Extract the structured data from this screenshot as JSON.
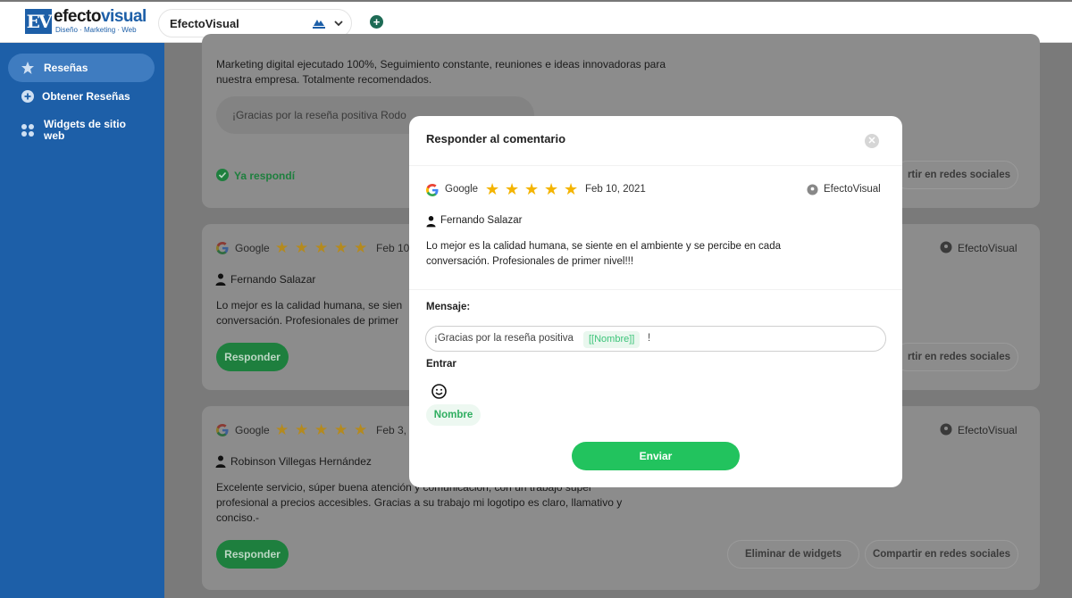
{
  "header": {
    "logo_word_a": "efecto",
    "logo_word_b": "visual",
    "logo_tagline": "Diseño · Marketing · Web",
    "account": "EfectoVisual"
  },
  "sidebar": {
    "items": [
      {
        "label": "Reseñas"
      },
      {
        "label": "Obtener Reseñas"
      },
      {
        "label": "Widgets de sitio web"
      }
    ]
  },
  "cards": [
    {
      "text": "Marketing digital ejecutado 100%, Seguimiento constante, reuniones e ideas innovadoras para nuestra empresa. Totalmente recomendados.",
      "reply_preview": "¡Gracias por la reseña positiva Rodo",
      "replied": "Ya respondí",
      "share": "rtir en redes sociales"
    },
    {
      "source": "Google",
      "date": "Feb 10,",
      "location": "EfectoVisual",
      "author": "Fernando Salazar",
      "text_line1": "Lo mejor es la calidad humana, se sien",
      "text_line2": "conversación. Profesionales de primer",
      "reply_button": "Responder",
      "share": "rtir en redes sociales"
    },
    {
      "source": "Google",
      "date": "Feb 3,",
      "location": "EfectoVisual",
      "author": "Robinson Villegas Hernández",
      "text_line1": "Excelente servicio, súper buena atención y comunicación, con un trabajo súper",
      "text_line2": "profesional a precios accesibles. Gracias a su trabajo mi logotipo es claro, llamativo y",
      "text_line3": "conciso.-",
      "reply_button": "Responder",
      "delete_widgets": "Eliminar de widgets",
      "share": "Compartir en redes sociales"
    }
  ],
  "modal": {
    "title": "Responder al comentario",
    "source": "Google",
    "rating": 5,
    "date": "Feb 10, 2021",
    "location": "EfectoVisual",
    "author": "Fernando Salazar",
    "review_line1": "Lo mejor es la calidad humana, se siente en el ambiente y se percibe en cada",
    "review_line2": "conversación. Profesionales de primer nivel!!!",
    "message_label": "Mensaje:",
    "message_prefix": "¡Gracias por la reseña positiva",
    "message_tag": "[[Nombre]]",
    "message_suffix": "!",
    "insert_label": "Entrar",
    "name_chip": "Nombre",
    "send_button": "Enviar"
  },
  "colors": {
    "sidebar": "#1d5fa8",
    "accent_green": "#22c35e",
    "star": "#f4b400"
  }
}
